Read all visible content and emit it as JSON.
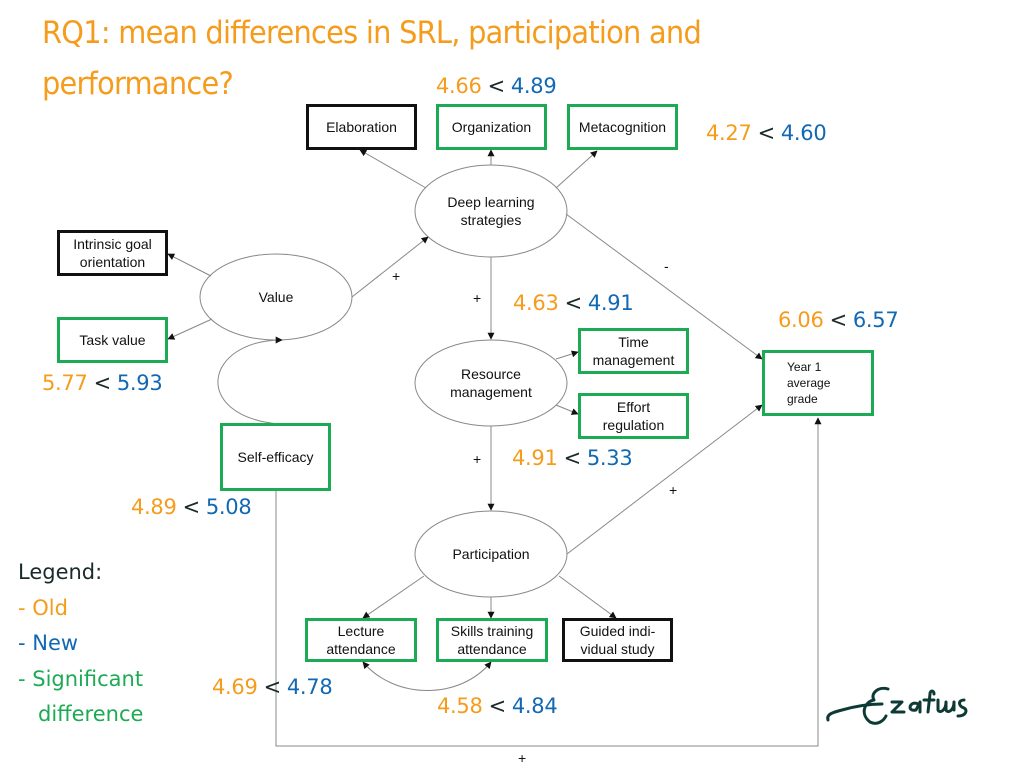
{
  "title": {
    "line1": "RQ1: mean differences in SRL, participation and",
    "line2": "performance?"
  },
  "colors": {
    "old": "#F59C1C",
    "new": "#1268B3",
    "significant": "#1DAA54",
    "non_significant_border": "#111111"
  },
  "nodes": {
    "elaboration": {
      "label": "Elaboration",
      "significant": false
    },
    "organization": {
      "label": "Organization",
      "significant": true
    },
    "metacognition": {
      "label": "Metacognition",
      "significant": true
    },
    "deep_learning": {
      "label": "Deep learning\nstrategies",
      "type": "latent"
    },
    "intrinsic_goal": {
      "label": "Intrinsic goal\norientation",
      "significant": false
    },
    "value": {
      "label": "Value",
      "type": "latent"
    },
    "task_value": {
      "label": "Task value",
      "significant": true
    },
    "self_efficacy": {
      "label": "Self-efficacy",
      "significant": true
    },
    "resource_mgmt": {
      "label": "Resource\nmanagement",
      "type": "latent"
    },
    "time_mgmt": {
      "label": "Time\nmanagement",
      "significant": true
    },
    "effort_reg": {
      "label": "Effort\nregulation",
      "significant": true
    },
    "participation": {
      "label": "Participation",
      "type": "latent"
    },
    "lecture_att": {
      "label": "Lecture\nattendance",
      "significant": true
    },
    "skills_att": {
      "label": "Skills training\nattendance",
      "significant": true
    },
    "guided_study": {
      "label": "Guided indi-\nvidual study",
      "significant": false
    },
    "year1_grade": {
      "label": "Year 1\naverage\ngrade",
      "significant": true
    }
  },
  "comparisons": {
    "organization": {
      "old": "4.66",
      "sep": "<",
      "new": "4.89"
    },
    "metacognition": {
      "old": "4.27",
      "sep": "<",
      "new": "4.60"
    },
    "task_value": {
      "old": "5.77",
      "sep": "<",
      "new": "5.93"
    },
    "time_mgmt": {
      "old": "4.63",
      "sep": "<",
      "new": "4.91"
    },
    "year1_grade": {
      "old": "6.06",
      "sep": "<",
      "new": "6.57"
    },
    "effort_reg": {
      "old": "4.91",
      "sep": "<",
      "new": "5.33"
    },
    "self_efficacy": {
      "old": "4.89",
      "sep": "<",
      "new": "5.08"
    },
    "lecture_att": {
      "old": "4.69",
      "sep": "<",
      "new": "4.78"
    },
    "skills_att": {
      "old": "4.58",
      "sep": "<",
      "new": "4.84"
    }
  },
  "path_signs": {
    "value_to_deep": "+",
    "deep_to_resource": "+",
    "deep_to_grade": "-",
    "resource_to_participation": "+",
    "participation_to_grade": "+",
    "self_efficacy_to_grade": "+"
  },
  "legend": {
    "header": "Legend:",
    "old": "- Old",
    "new": "- New",
    "significant_line1": "- Significant",
    "significant_line2": "difference"
  },
  "logo": {
    "name": "erasmus-logo"
  }
}
